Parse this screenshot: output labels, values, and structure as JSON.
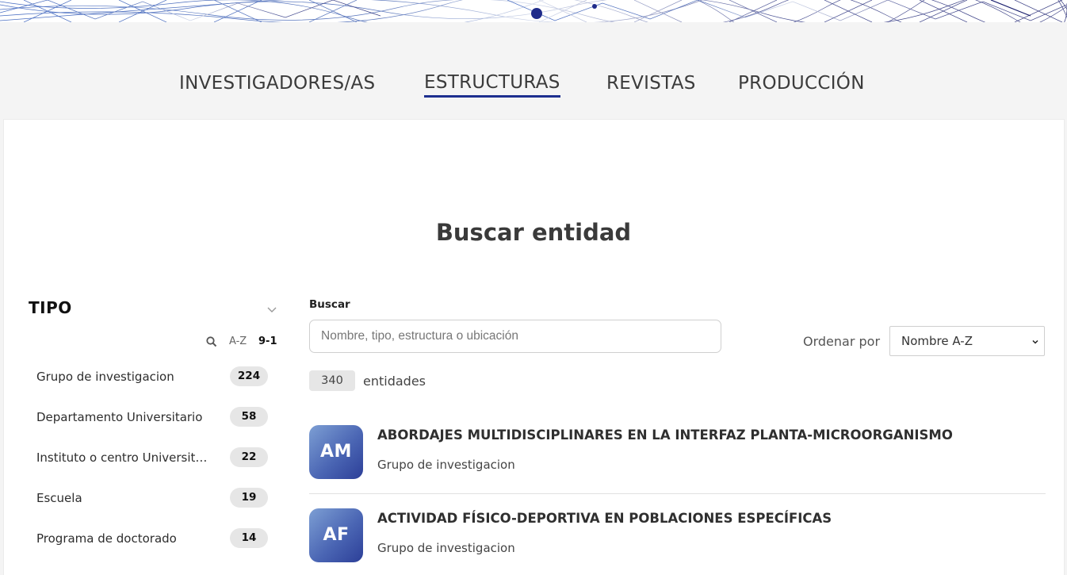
{
  "nav": {
    "items": [
      {
        "label": "INVESTIGADORES/AS"
      },
      {
        "label": "ESTRUCTURAS"
      },
      {
        "label": "REVISTAS"
      },
      {
        "label": "PRODUCCIÓN"
      }
    ],
    "active_index": 1
  },
  "page": {
    "title": "Buscar entidad"
  },
  "filter": {
    "title": "TIPO",
    "sort_az": "A-Z",
    "sort_91": "9-1",
    "facets": [
      {
        "label": "Grupo de investigacion",
        "count": "224"
      },
      {
        "label": "Departamento Universitario",
        "count": "58"
      },
      {
        "label": "Instituto o centro Universitario",
        "count": "22"
      },
      {
        "label": "Escuela",
        "count": "19"
      },
      {
        "label": "Programa de doctorado",
        "count": "14"
      }
    ]
  },
  "search": {
    "label": "Buscar",
    "placeholder": "Nombre, tipo, estructura o ubicación",
    "value": ""
  },
  "order": {
    "label": "Ordenar por",
    "selected": "Nombre A-Z"
  },
  "results": {
    "count": "340",
    "count_label": "entidades",
    "items": [
      {
        "initials": "AM",
        "title": "ABORDAJES MULTIDISCIPLINARES EN LA INTERFAZ PLANTA-MICROORGANISMO",
        "type": "Grupo de investigacion"
      },
      {
        "initials": "AF",
        "title": "ACTIVIDAD FÍSICO-DEPORTIVA EN POBLACIONES ESPECÍFICAS",
        "type": "Grupo de investigacion"
      }
    ]
  },
  "colors": {
    "accent": "#1d2f8f",
    "avatar_gradient_end": "#2c3f98",
    "badge_bg": "#e6e6e6"
  },
  "icons": {
    "sort": "search-icon",
    "filter_toggle": "chevron-down-icon",
    "select": "chevron-down-icon"
  }
}
